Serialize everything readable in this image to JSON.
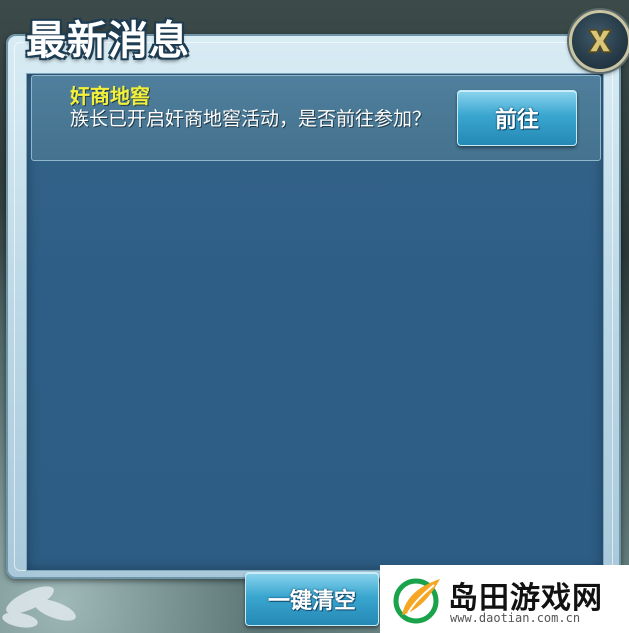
{
  "dialog": {
    "title": "最新消息",
    "close_label": "X"
  },
  "messages": [
    {
      "title": "奸商地窖",
      "body": "族长已开启奸商地窖活动，是否前往参加？",
      "action_label": "前往"
    }
  ],
  "footer": {
    "clear_all_label": "一键清空"
  },
  "watermark": {
    "name": "岛田游戏网",
    "url": "www.daotian.com.cn"
  },
  "colors": {
    "message_title": "#f3f03a",
    "panel_bg": "#2e5e86",
    "button": "#3aa6cf",
    "close_x": "#d8c77a"
  },
  "icons": {
    "close": "close-x-icon",
    "watermark_logo": "leaf-logo-icon"
  }
}
